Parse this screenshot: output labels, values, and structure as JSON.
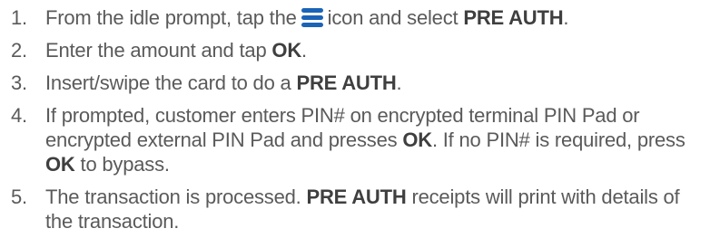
{
  "instructions": [
    {
      "number": "1.",
      "pre": "From the idle prompt, tap the",
      "icon": "menu-icon",
      "post": "icon and select",
      "keyword": "PRE AUTH",
      "end": "."
    },
    {
      "number": "2.",
      "pre": "Enter the amount and tap",
      "keyword": "OK",
      "end": "."
    },
    {
      "number": "3.",
      "pre": "Insert/swipe the card to do a",
      "keyword": "PRE AUTH",
      "end": "."
    },
    {
      "number": "4.",
      "pre": "If prompted, customer enters PIN# on encrypted terminal PIN Pad or encrypted external PIN Pad and presses",
      "keyword1": "OK",
      "mid": ". If no PIN# is required, press",
      "keyword2": "OK",
      "end": "to bypass."
    },
    {
      "number": "5.",
      "pre": "The transaction is processed.",
      "keyword": "PRE AUTH",
      "end": "receipts will print with details of the transaction."
    }
  ],
  "colors": {
    "text": "#5a5a5a",
    "keyword": "#3f3f3f",
    "icon": "#1a64b8"
  }
}
